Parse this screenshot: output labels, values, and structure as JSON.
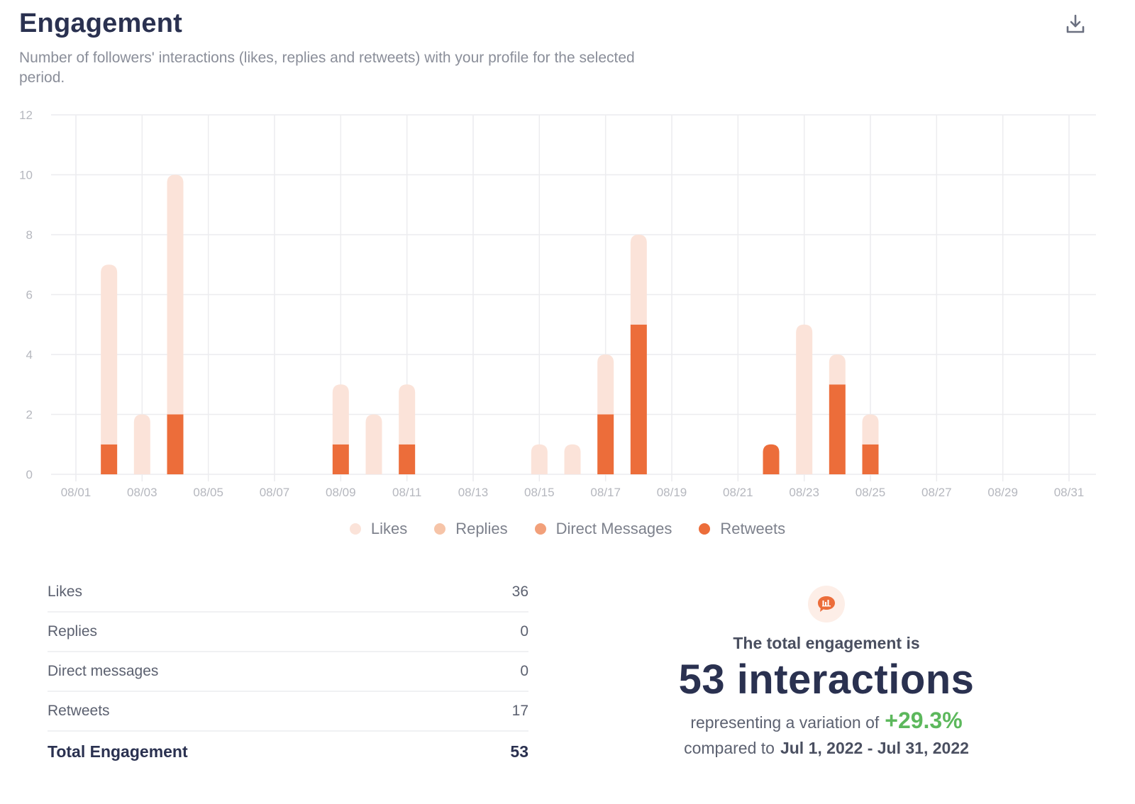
{
  "header": {
    "title": "Engagement",
    "subtitle": "Number of followers' interactions (likes, replies and retweets) with your profile for the selected period.",
    "download_icon": "download-icon"
  },
  "colors": {
    "likes": "#fbe3d9",
    "replies": "#f6c4a8",
    "direct_messages": "#f2a07a",
    "retweets": "#ec6d3a",
    "grid": "#ececef",
    "positive": "#5cb85c"
  },
  "chart_data": {
    "type": "bar",
    "stacked": true,
    "title": "Engagement",
    "xlabel": "",
    "ylabel": "",
    "ylim": [
      0,
      12
    ],
    "yticks": [
      0,
      2,
      4,
      6,
      8,
      10,
      12
    ],
    "grid": true,
    "legend_position": "bottom-center",
    "categories": [
      "08/01",
      "08/02",
      "08/03",
      "08/04",
      "08/05",
      "08/06",
      "08/07",
      "08/08",
      "08/09",
      "08/10",
      "08/11",
      "08/12",
      "08/13",
      "08/14",
      "08/15",
      "08/16",
      "08/17",
      "08/18",
      "08/19",
      "08/20",
      "08/21",
      "08/22",
      "08/23",
      "08/24",
      "08/25",
      "08/26",
      "08/27",
      "08/28",
      "08/29",
      "08/30",
      "08/31"
    ],
    "xtick_labels": [
      "08/01",
      "08/03",
      "08/05",
      "08/07",
      "08/09",
      "08/11",
      "08/13",
      "08/15",
      "08/17",
      "08/19",
      "08/21",
      "08/23",
      "08/25",
      "08/27",
      "08/29",
      "08/31"
    ],
    "series": [
      {
        "name": "Retweets",
        "key": "retweets",
        "values": [
          0,
          1,
          0,
          2,
          0,
          0,
          0,
          0,
          1,
          0,
          1,
          0,
          0,
          0,
          0,
          0,
          2,
          5,
          0,
          0,
          0,
          1,
          0,
          3,
          1,
          0,
          0,
          0,
          0,
          0,
          0
        ]
      },
      {
        "name": "Direct Messages",
        "key": "direct_messages",
        "values": [
          0,
          0,
          0,
          0,
          0,
          0,
          0,
          0,
          0,
          0,
          0,
          0,
          0,
          0,
          0,
          0,
          0,
          0,
          0,
          0,
          0,
          0,
          0,
          0,
          0,
          0,
          0,
          0,
          0,
          0,
          0
        ]
      },
      {
        "name": "Replies",
        "key": "replies",
        "values": [
          0,
          0,
          0,
          0,
          0,
          0,
          0,
          0,
          0,
          0,
          0,
          0,
          0,
          0,
          0,
          0,
          0,
          0,
          0,
          0,
          0,
          0,
          0,
          0,
          0,
          0,
          0,
          0,
          0,
          0,
          0
        ]
      },
      {
        "name": "Likes",
        "key": "likes",
        "values": [
          0,
          6,
          2,
          8,
          0,
          0,
          0,
          0,
          2,
          2,
          2,
          0,
          0,
          0,
          1,
          1,
          2,
          3,
          0,
          0,
          0,
          0,
          5,
          1,
          1,
          0,
          0,
          0,
          0,
          0,
          0
        ]
      }
    ]
  },
  "legend": [
    {
      "label": "Likes",
      "key": "likes"
    },
    {
      "label": "Replies",
      "key": "replies"
    },
    {
      "label": "Direct Messages",
      "key": "direct_messages"
    },
    {
      "label": "Retweets",
      "key": "retweets"
    }
  ],
  "stats": {
    "rows": [
      {
        "label": "Likes",
        "value": "36"
      },
      {
        "label": "Replies",
        "value": "0"
      },
      {
        "label": "Direct messages",
        "value": "0"
      },
      {
        "label": "Retweets",
        "value": "17"
      }
    ],
    "total": {
      "label": "Total Engagement",
      "value": "53"
    }
  },
  "summary": {
    "icon": "chat-chart-icon",
    "lead": "The total engagement is",
    "headline": "53 interactions",
    "variation_prefix": "representing a variation of",
    "variation_value": "+29.3%",
    "compare_prefix": "compared to",
    "compare_range": "Jul 1, 2022 - Jul 31, 2022"
  }
}
